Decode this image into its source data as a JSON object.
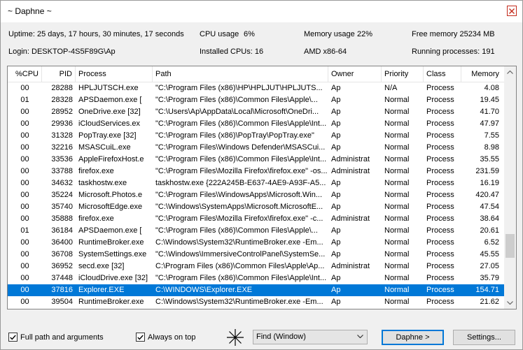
{
  "window": {
    "title": "~ Daphne ~"
  },
  "info": {
    "uptime": "Uptime: 25 days, 17 hours, 30 minutes, 17 seconds",
    "cpu_usage_label": "CPU usage",
    "cpu_usage_value": "6%",
    "memory_usage_label": "Memory usage",
    "memory_usage_value": "22%",
    "free_memory": "Free memory 25234 MB",
    "login": "Login: DESKTOP-4S5F89G\\Ap",
    "installed_cpus": "Installed CPUs: 16",
    "arch": "AMD x86-64",
    "running_processes": "Running processes:  191"
  },
  "table": {
    "columns": [
      "%CPU",
      "PID",
      "Process",
      "Path",
      "Owner",
      "Priority",
      "Class",
      "Memory"
    ],
    "rows": [
      [
        "00",
        "28288",
        "HPLJUTSCH.exe",
        "\"C:\\Program Files (x86)\\HP\\HPLJUT\\HPLJUTS...",
        "Ap",
        "N/A",
        "Process",
        "4.08"
      ],
      [
        "01",
        "28328",
        "APSDaemon.exe [",
        "\"C:\\Program Files (x86)\\Common Files\\Apple\\...",
        "Ap",
        "Normal",
        "Process",
        "19.45"
      ],
      [
        "00",
        "28952",
        "OneDrive.exe [32]",
        "\"C:\\Users\\Ap\\AppData\\Local\\Microsoft\\OneDri...",
        "Ap",
        "Normal",
        "Process",
        "41.70"
      ],
      [
        "00",
        "29936",
        "iCloudServices.ex",
        "\"C:\\Program Files (x86)\\Common Files\\Apple\\Int...",
        "Ap",
        "Normal",
        "Process",
        "47.97"
      ],
      [
        "00",
        "31328",
        "PopTray.exe [32]",
        "\"C:\\Program Files (x86)\\PopTray\\PopTray.exe\"",
        "Ap",
        "Normal",
        "Process",
        "7.55"
      ],
      [
        "00",
        "32216",
        "MSASCuiL.exe",
        "\"C:\\Program Files\\Windows Defender\\MSASCui...",
        "Ap",
        "Normal",
        "Process",
        "8.98"
      ],
      [
        "00",
        "33536",
        "AppleFirefoxHost.e",
        "\"C:\\Program Files (x86)\\Common Files\\Apple\\Int...",
        "Administrat",
        "Normal",
        "Process",
        "35.55"
      ],
      [
        "00",
        "33788",
        "firefox.exe",
        "\"C:\\Program Files\\Mozilla Firefox\\firefox.exe\" -os...",
        "Administrat",
        "Normal",
        "Process",
        "231.59"
      ],
      [
        "00",
        "34632",
        "taskhostw.exe",
        "taskhostw.exe {222A245B-E637-4AE9-A93F-A5...",
        "Ap",
        "Normal",
        "Process",
        "16.19"
      ],
      [
        "00",
        "35224",
        "Microsoft.Photos.e",
        "\"C:\\Program Files\\WindowsApps\\Microsoft.Win...",
        "Ap",
        "Normal",
        "Process",
        "420.47"
      ],
      [
        "00",
        "35740",
        "MicrosoftEdge.exe",
        "\"C:\\Windows\\SystemApps\\Microsoft.MicrosoftE...",
        "Ap",
        "Normal",
        "Process",
        "47.54"
      ],
      [
        "00",
        "35888",
        "firefox.exe",
        "\"C:\\Program Files\\Mozilla Firefox\\firefox.exe\" -c...",
        "Administrat",
        "Normal",
        "Process",
        "38.64"
      ],
      [
        "01",
        "36184",
        "APSDaemon.exe [",
        "\"C:\\Program Files (x86)\\Common Files\\Apple\\...",
        "Ap",
        "Normal",
        "Process",
        "20.61"
      ],
      [
        "00",
        "36400",
        "RuntimeBroker.exe",
        "C:\\Windows\\System32\\RuntimeBroker.exe -Em...",
        "Ap",
        "Normal",
        "Process",
        "6.52"
      ],
      [
        "00",
        "36708",
        "SystemSettings.exe",
        "\"C:\\Windows\\ImmersiveControlPanel\\SystemSe...",
        "Ap",
        "Normal",
        "Process",
        "45.55"
      ],
      [
        "00",
        "36952",
        "secd.exe [32]",
        "C:\\Program Files (x86)\\Common Files\\Apple\\Ap...",
        "Administrat",
        "Normal",
        "Process",
        "27.05"
      ],
      [
        "00",
        "37448",
        "iCloudDrive.exe [32]",
        "\"C:\\Program Files (x86)\\Common Files\\Apple\\Int...",
        "Ap",
        "Normal",
        "Process",
        "35.79"
      ],
      [
        "00",
        "37816",
        "Explorer.EXE",
        "C:\\WINDOWS\\Explorer.EXE",
        "Ap",
        "Normal",
        "Process",
        "154.71"
      ],
      [
        "00",
        "39504",
        "RuntimeBroker.exe",
        "C:\\Windows\\System32\\RuntimeBroker.exe -Em...",
        "Ap",
        "Normal",
        "Process",
        "21.62"
      ]
    ],
    "selected_pid": "37816"
  },
  "footer": {
    "full_path_label": "Full path and arguments",
    "always_on_top_label": "Always on top",
    "find_value": "Find (Window)",
    "daphne_button": "Daphne >",
    "settings_button": "Settings..."
  },
  "colors": {
    "selection": "#0078d7",
    "close_border": "#c42b1c"
  }
}
